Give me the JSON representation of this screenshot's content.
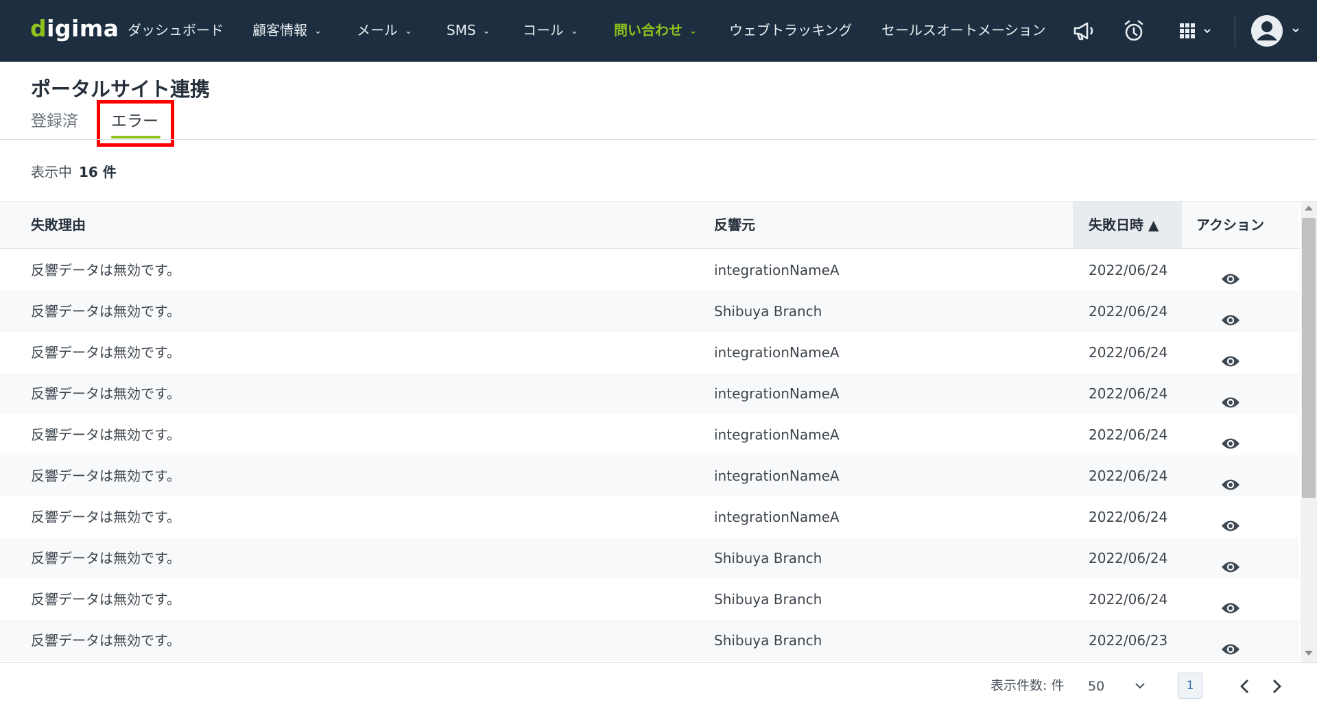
{
  "app": {
    "logo": "digima",
    "logo_first": "d",
    "logo_rest": "igima"
  },
  "nav": {
    "items": [
      {
        "label": "ダッシュボード",
        "has_dropdown": false
      },
      {
        "label": "顧客情報",
        "has_dropdown": true
      },
      {
        "label": "メール",
        "has_dropdown": true
      },
      {
        "label": "SMS",
        "has_dropdown": true
      },
      {
        "label": "コール",
        "has_dropdown": true
      },
      {
        "label": "問い合わせ",
        "has_dropdown": true,
        "active": true
      },
      {
        "label": "ウェブトラッキング",
        "has_dropdown": false
      },
      {
        "label": "セールスオートメーション",
        "has_dropdown": false
      }
    ],
    "icons": [
      "megaphone-icon",
      "alarm-clock-icon",
      "app-grid-icon",
      "user-avatar-icon"
    ],
    "dropdown_glyph": "⌄"
  },
  "page": {
    "title": "ポータルサイト連携",
    "tabs": [
      {
        "label": "登録済",
        "active": false
      },
      {
        "label": "エラー",
        "active": true
      }
    ],
    "count_prefix": "表示中",
    "count_value": "16 件"
  },
  "table": {
    "columns": {
      "reason": "失敗理由",
      "source": "反響元",
      "date": "失敗日時 ▲",
      "action": "アクション"
    },
    "sorted_column": "date",
    "rows": [
      {
        "reason": "反響データは無効です。",
        "source": "integrationNameA",
        "date": "2022/06/24",
        "action_icon": "eye-icon"
      },
      {
        "reason": "反響データは無効です。",
        "source": "Shibuya Branch",
        "date": "2022/06/24",
        "action_icon": "eye-icon"
      },
      {
        "reason": "反響データは無効です。",
        "source": "integrationNameA",
        "date": "2022/06/24",
        "action_icon": "eye-icon"
      },
      {
        "reason": "反響データは無効です。",
        "source": "integrationNameA",
        "date": "2022/06/24",
        "action_icon": "eye-icon"
      },
      {
        "reason": "反響データは無効です。",
        "source": "integrationNameA",
        "date": "2022/06/24",
        "action_icon": "eye-icon"
      },
      {
        "reason": "反響データは無効です。",
        "source": "integrationNameA",
        "date": "2022/06/24",
        "action_icon": "eye-icon"
      },
      {
        "reason": "反響データは無効です。",
        "source": "integrationNameA",
        "date": "2022/06/24",
        "action_icon": "eye-icon"
      },
      {
        "reason": "反響データは無効です。",
        "source": "Shibuya Branch",
        "date": "2022/06/24",
        "action_icon": "eye-icon"
      },
      {
        "reason": "反響データは無効です。",
        "source": "Shibuya Branch",
        "date": "2022/06/24",
        "action_icon": "eye-icon"
      },
      {
        "reason": "反響データは無効です。",
        "source": "Shibuya Branch",
        "date": "2022/06/23",
        "action_icon": "eye-icon"
      }
    ]
  },
  "pagination": {
    "per_page_label": "表示件数: 件",
    "per_page_value": "50",
    "current_page": "1",
    "icons": [
      "chevron-down-icon",
      "chevron-left-icon",
      "chevron-right-icon"
    ]
  },
  "colors": {
    "nav_bg": "#1c2e3f",
    "accent": "#8dc21f",
    "annotation": "#ff0000"
  }
}
